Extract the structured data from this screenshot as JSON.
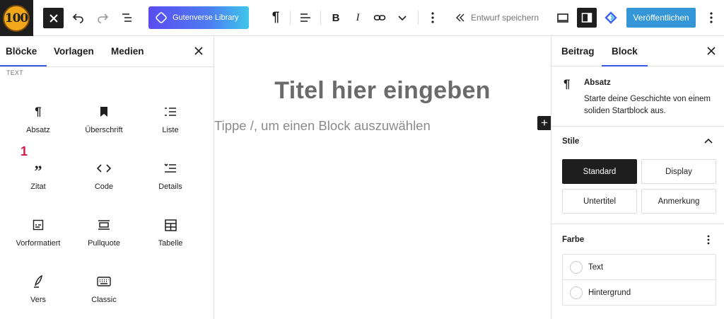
{
  "logo": {
    "text": "100"
  },
  "toolbar": {
    "library_label": "Gutenverse Library",
    "save_draft_label": "Entwurf speichern",
    "publish_label": "Veröffentlichen",
    "icons": [
      "close-icon",
      "undo-icon",
      "redo-icon",
      "document-overview-icon",
      "paragraph-icon",
      "align-icon",
      "bold-icon",
      "italic-icon",
      "link-icon",
      "chevron-down-icon",
      "more-options-icon",
      "chevrons-left-icon",
      "desktop-preview-icon",
      "sidebar-toggle-icon",
      "gutenverse-icon",
      "more-vertical-icon"
    ]
  },
  "inserter": {
    "tabs": [
      "Blöcke",
      "Vorlagen",
      "Medien"
    ],
    "active_tab": "Blöcke",
    "category": "TEXT",
    "blocks": [
      {
        "label": "Absatz",
        "icon": "paragraph-icon"
      },
      {
        "label": "Überschrift",
        "icon": "bookmark-icon"
      },
      {
        "label": "Liste",
        "icon": "list-icon"
      },
      {
        "label": "Zitat",
        "icon": "quote-icon"
      },
      {
        "label": "Code",
        "icon": "code-icon"
      },
      {
        "label": "Details",
        "icon": "details-icon"
      },
      {
        "label": "Vorformatiert",
        "icon": "preformatted-icon"
      },
      {
        "label": "Pullquote",
        "icon": "pullquote-icon"
      },
      {
        "label": "Tabelle",
        "icon": "table-icon"
      },
      {
        "label": "Vers",
        "icon": "verse-icon"
      },
      {
        "label": "Classic",
        "icon": "keyboard-icon"
      }
    ],
    "annotation": "1"
  },
  "editor": {
    "title_placeholder": "Titel hier eingeben",
    "block_placeholder": "Tippe /, um einen Block auszuwählen"
  },
  "settings": {
    "tabs": [
      "Beitrag",
      "Block"
    ],
    "active_tab": "Block",
    "block_name": "Absatz",
    "block_description": "Starte deine Geschichte von einem soliden Startblock aus.",
    "styles_heading": "Stile",
    "styles": [
      "Standard",
      "Display",
      "Untertitel",
      "Anmerkung"
    ],
    "selected_style": "Standard",
    "color_heading": "Farbe",
    "colors": [
      "Text",
      "Hintergrund"
    ]
  },
  "colors": {
    "accent": "#3858e9",
    "publish": "#3596d7",
    "annotation": "#d6183f"
  }
}
